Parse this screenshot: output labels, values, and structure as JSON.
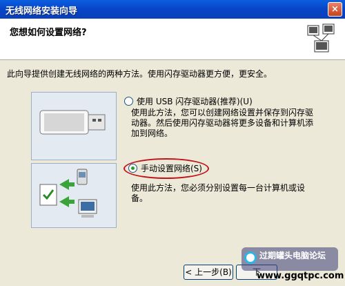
{
  "window": {
    "title": "无线网络安装向导",
    "close_label": "×"
  },
  "header": {
    "title": "您想如何设置网络?"
  },
  "intro": "此向导提供创建无线网络的两种方法。使用闪存驱动器更方便，更安全。",
  "options": [
    {
      "label": "使用 USB 闪存驱动器(推荐)(U)",
      "checked": false,
      "desc_line1": "使用此方法，您可以创建网络设置并保存到闪存驱",
      "desc_line2": "动器。然后使用闪存驱动器将更多设备和计算机添",
      "desc_line3": "加到网络。"
    },
    {
      "label": "手动设置网络(S)",
      "checked": true,
      "desc_line1": "使用此方法，您必须分别设置每一台计算机或设",
      "desc_line2": "备。"
    }
  ],
  "buttons": {
    "back": "< 上一步(B)",
    "next": "下"
  },
  "watermark": {
    "text": "过期罐头电脑论坛",
    "url": "www.ggqtpc.com"
  },
  "colors": {
    "accent_red": "#c0141b",
    "titlebar": "#0a5fe0"
  }
}
